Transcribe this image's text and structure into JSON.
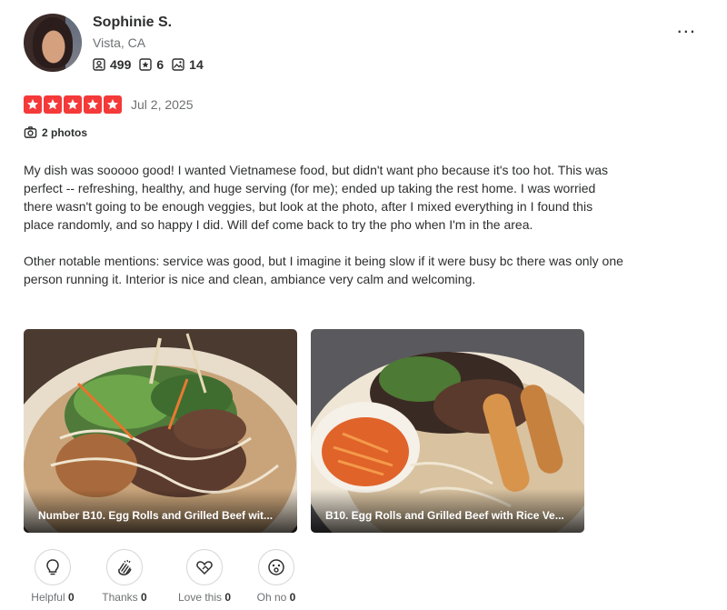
{
  "user": {
    "name": "Sophinie S.",
    "location": "Vista, CA",
    "stats": {
      "friends": "499",
      "reviews": "6",
      "photos": "14"
    }
  },
  "more_label": "...",
  "review": {
    "rating": 5,
    "date": "Jul 2, 2025",
    "photo_count": "2 photos",
    "paragraphs": [
      "My dish was sooooo good! I wanted Vietnamese food, but didn't want pho because it's too hot. This was perfect -- refreshing, healthy, and huge serving (for me); ended up taking the rest home. I was worried there wasn't going to be enough veggies, but look at the photo, after I mixed everything in I found this place randomly, and so happy I did. Will def come back to try the pho when I'm in the area.",
      "Other notable mentions: service was good, but I imagine it being slow if it were busy bc there was only one person running it. Interior is nice and clean, ambiance very calm and welcoming."
    ]
  },
  "photos": [
    {
      "caption": "Number B10. Egg Rolls and Grilled Beef wit..."
    },
    {
      "caption": "B10. Egg Rolls and Grilled Beef with Rice Ve..."
    }
  ],
  "reactions": [
    {
      "label": "Helpful",
      "count": "0",
      "icon": "lightbulb-icon"
    },
    {
      "label": "Thanks",
      "count": "0",
      "icon": "clapping-hands-icon"
    },
    {
      "label": "Love this",
      "count": "0",
      "icon": "heart-hand-icon"
    },
    {
      "label": "Oh no",
      "count": "0",
      "icon": "surprised-face-icon"
    }
  ],
  "colors": {
    "star_red": "#f43939",
    "text": "#2d2e2f",
    "muted": "#6e7072"
  }
}
